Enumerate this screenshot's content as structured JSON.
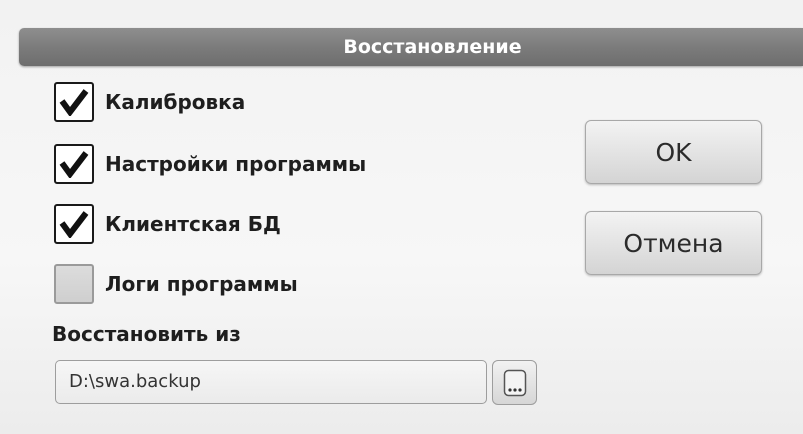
{
  "dialog": {
    "title": "Восстановление"
  },
  "options": [
    {
      "label": "Калибровка",
      "checked": true
    },
    {
      "label": "Настройки программы",
      "checked": true
    },
    {
      "label": "Клиентская БД",
      "checked": true
    },
    {
      "label": "Логи программы",
      "checked": false
    }
  ],
  "buttons": {
    "ok_label": "OK",
    "cancel_label": "Отмена"
  },
  "restore_from": {
    "label": "Восстановить из",
    "value": "D:\\swa.backup"
  },
  "icons": {
    "check": "check-icon",
    "browse": "browse-ellipsis-icon"
  },
  "colors": {
    "titlebar": "#7a7a7a",
    "title_text": "#ffffff",
    "checkmark": "#111111"
  }
}
